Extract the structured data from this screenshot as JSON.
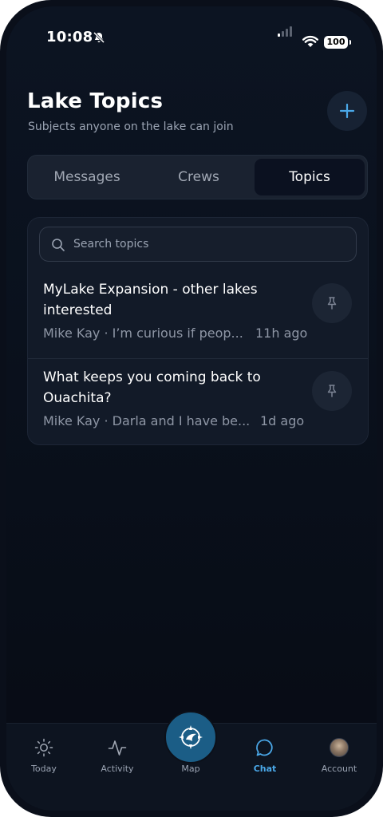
{
  "status_bar": {
    "time": "10:08",
    "battery": "100"
  },
  "header": {
    "title": "Lake Topics",
    "subtitle": "Subjects anyone on the lake can join"
  },
  "tabs": [
    {
      "label": "Messages",
      "selected": false
    },
    {
      "label": "Crews",
      "selected": false
    },
    {
      "label": "Topics",
      "selected": true
    }
  ],
  "search": {
    "placeholder": "Search topics",
    "value": ""
  },
  "topics": [
    {
      "title": "MyLake Expansion - other lakes interested",
      "preview": "Mike Kay · I’m curious if peop...",
      "time": "11h ago"
    },
    {
      "title": "What keeps you coming back to Ouachita?",
      "preview": "Mike Kay · Darla and I have be...",
      "time": "1d ago"
    }
  ],
  "nav": [
    {
      "label": "Today",
      "icon": "sun-icon"
    },
    {
      "label": "Activity",
      "icon": "activity-icon"
    },
    {
      "label": "Map",
      "icon": "compass-icon"
    },
    {
      "label": "Chat",
      "icon": "chat-bubble-icon",
      "active": true
    },
    {
      "label": "Account",
      "icon": "avatar"
    }
  ],
  "colors": {
    "accent": "#4aa8e8",
    "background": "#070b14",
    "card": "#121a28"
  }
}
